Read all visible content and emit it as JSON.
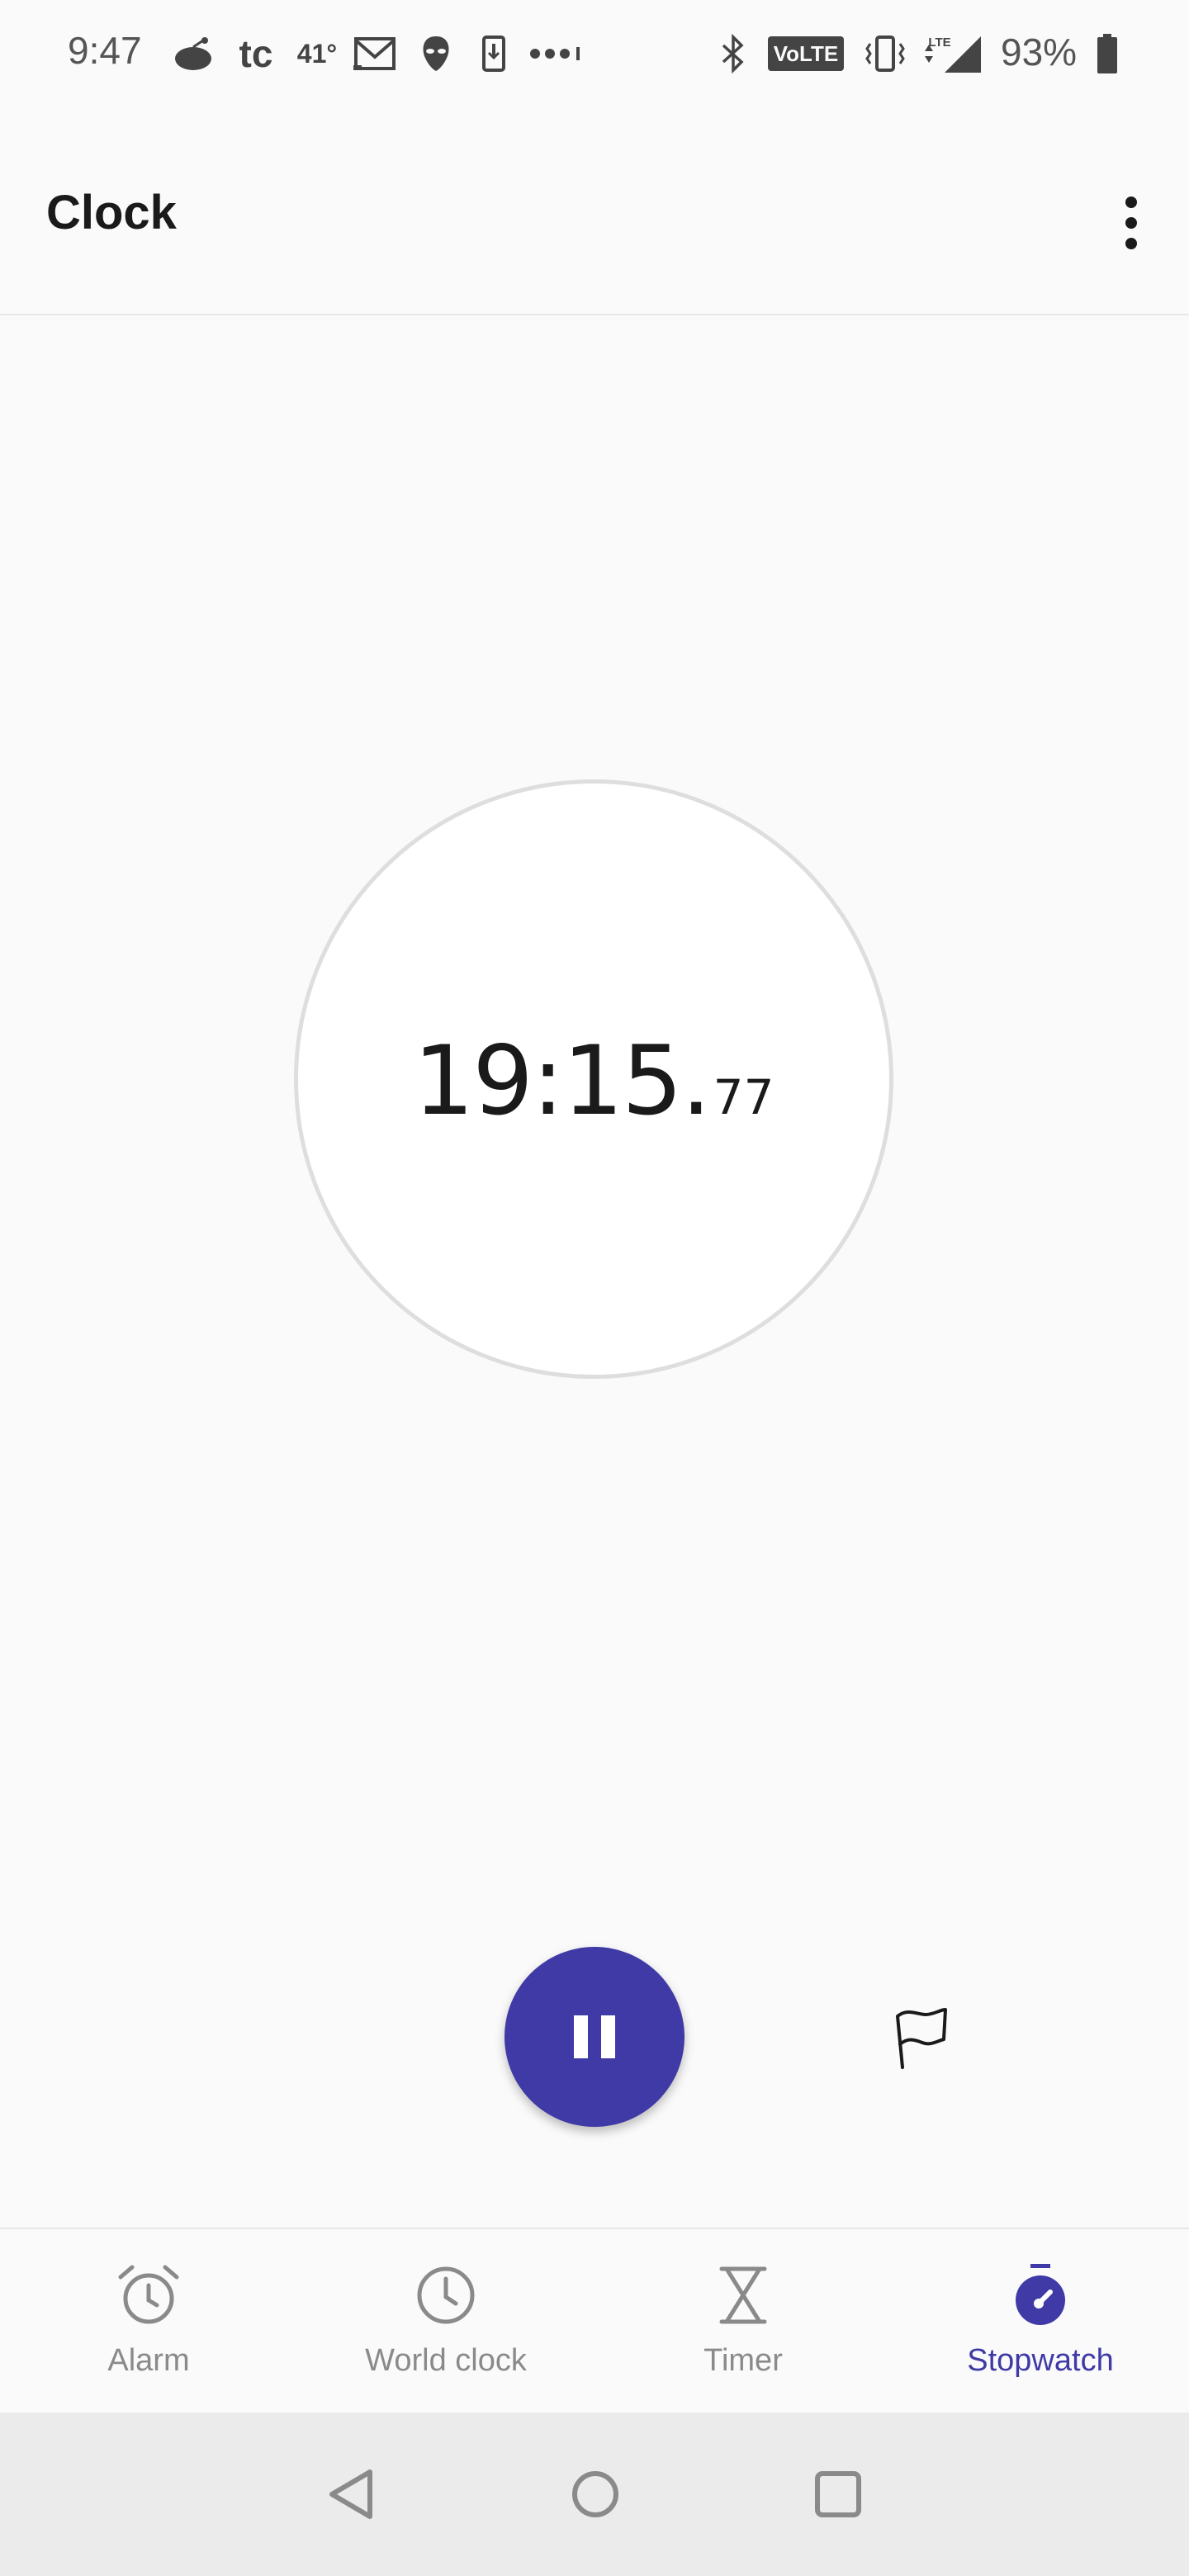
{
  "status_bar": {
    "time": "9:47",
    "weather_temp": "41°",
    "tc_label": "tc",
    "volte_label": "VoLTE",
    "lte_label": "LTE",
    "battery_percent": "93%"
  },
  "app_bar": {
    "title": "Clock"
  },
  "stopwatch": {
    "time_main": "19:15.",
    "time_centis": "77"
  },
  "bottom_nav": {
    "items": [
      {
        "label": "Alarm",
        "icon": "alarm-icon",
        "active": false
      },
      {
        "label": "World clock",
        "icon": "clock-icon",
        "active": false
      },
      {
        "label": "Timer",
        "icon": "hourglass-icon",
        "active": false
      },
      {
        "label": "Stopwatch",
        "icon": "stopwatch-icon",
        "active": true
      }
    ]
  },
  "colors": {
    "accent": "#3f3aa6",
    "inactive": "#8a8a8a",
    "background": "#fafafa"
  }
}
